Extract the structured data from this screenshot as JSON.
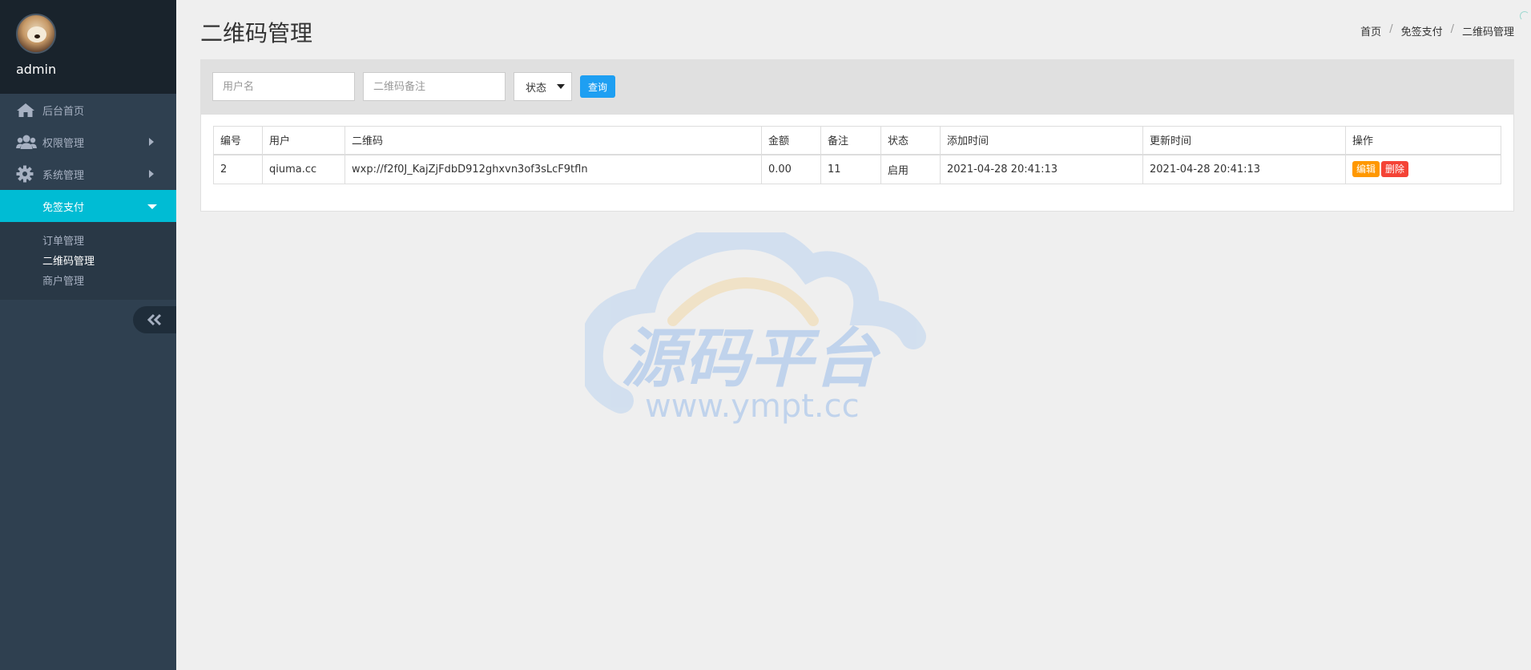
{
  "user": {
    "name": "admin"
  },
  "sidebar": {
    "items": [
      {
        "label": "后台首页",
        "icon": "home-icon"
      },
      {
        "label": "权限管理",
        "icon": "users-icon"
      },
      {
        "label": "系统管理",
        "icon": "gear-icon"
      },
      {
        "label": "免签支付",
        "active": true
      }
    ],
    "subitems": [
      {
        "label": "订单管理"
      },
      {
        "label": "二维码管理",
        "current": true
      },
      {
        "label": "商户管理"
      }
    ]
  },
  "page": {
    "title": "二维码管理"
  },
  "breadcrumb": [
    "首页",
    "免签支付",
    "二维码管理"
  ],
  "search": {
    "username_placeholder": "用户名",
    "remark_placeholder": "二维码备注",
    "status_selected": "状态",
    "query_label": "查询"
  },
  "table": {
    "headers": [
      "编号",
      "用户",
      "二维码",
      "金额",
      "备注",
      "状态",
      "添加时间",
      "更新时间",
      "操作"
    ],
    "rows": [
      {
        "id": "2",
        "user": "qiuma.cc",
        "qrcode": "wxp://f2f0J_KajZjFdbD912ghxvn3of3sLcF9tfln",
        "amount": "0.00",
        "remark": "11",
        "status": "启用",
        "created": "2021-04-28 20:41:13",
        "updated": "2021-04-28 20:41:13",
        "edit_label": "编辑",
        "delete_label": "删除"
      }
    ]
  },
  "watermark": {
    "title": "源码平台",
    "url": "www.ympt.cc"
  },
  "colors": {
    "sidebar_bg": "#2f4050",
    "active_nav": "#00bcd4",
    "query_button": "#1e9ff2",
    "edit_button": "#ff9800",
    "delete_button": "#f44336"
  }
}
